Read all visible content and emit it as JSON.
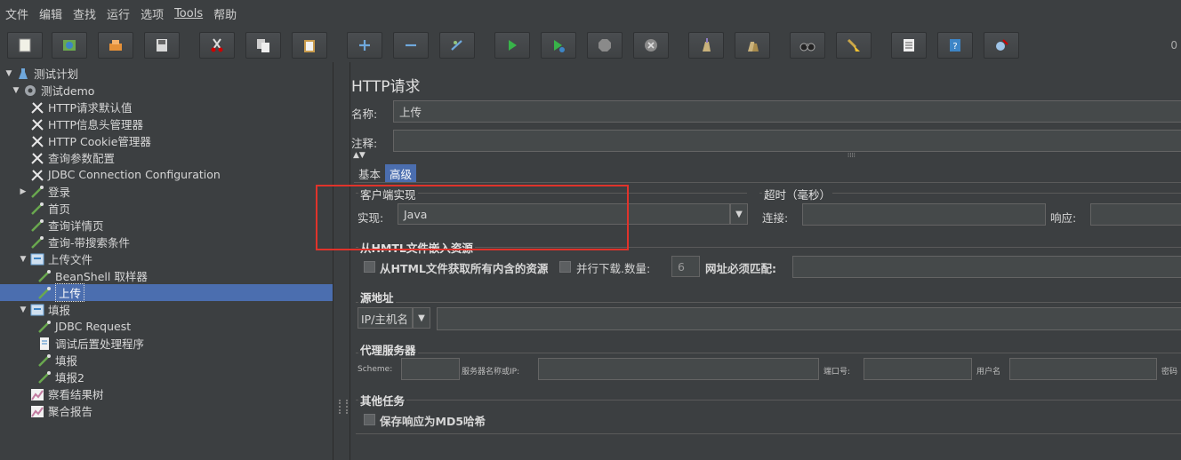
{
  "menubar": {
    "items": [
      "文件",
      "编辑",
      "查找",
      "运行",
      "选项",
      "Tools",
      "帮助"
    ]
  },
  "toolbar": {
    "buttons": [
      {
        "icon": "new-file-icon"
      },
      {
        "icon": "templates-icon"
      },
      {
        "icon": "open-icon"
      },
      {
        "icon": "save-icon"
      },
      {
        "icon": "cut-icon"
      },
      {
        "icon": "copy-icon"
      },
      {
        "icon": "paste-icon"
      },
      {
        "icon": "expand-icon"
      },
      {
        "icon": "collapse-icon"
      },
      {
        "icon": "toggle-icon"
      },
      {
        "icon": "start-icon"
      },
      {
        "icon": "start-no-pause-icon"
      },
      {
        "icon": "stop-icon"
      },
      {
        "icon": "shutdown-icon"
      },
      {
        "icon": "clear-icon"
      },
      {
        "icon": "clear-all-icon"
      },
      {
        "icon": "search-icon"
      },
      {
        "icon": "reset-search-icon"
      },
      {
        "icon": "function-helper-icon"
      },
      {
        "icon": "help-icon"
      },
      {
        "icon": "remote-icon"
      }
    ],
    "counter": "0"
  },
  "tree": {
    "items": [
      {
        "label": "测试计划",
        "icon": "flask-icon"
      },
      {
        "label": "测试demo",
        "icon": "gear-icon"
      },
      {
        "label": "HTTP请求默认值",
        "icon": "wrench-icon"
      },
      {
        "label": "HTTP信息头管理器",
        "icon": "wrench-icon"
      },
      {
        "label": "HTTP Cookie管理器",
        "icon": "wrench-icon"
      },
      {
        "label": "查询参数配置",
        "icon": "wrench-icon"
      },
      {
        "label": "JDBC Connection Configuration",
        "icon": "wrench-icon"
      },
      {
        "label": "登录",
        "icon": "pipette-icon"
      },
      {
        "label": "首页",
        "icon": "pipette-icon"
      },
      {
        "label": "查询详情页",
        "icon": "pipette-icon"
      },
      {
        "label": "查询-带搜索条件",
        "icon": "pipette-icon"
      },
      {
        "label": "上传文件",
        "icon": "controller-icon"
      },
      {
        "label": "BeanShell 取样器",
        "icon": "pipette-icon"
      },
      {
        "label": "上传",
        "icon": "pipette-icon"
      },
      {
        "label": "填报",
        "icon": "controller-icon"
      },
      {
        "label": "JDBC Request",
        "icon": "pipette-icon"
      },
      {
        "label": "调试后置处理程序",
        "icon": "document-icon"
      },
      {
        "label": "填报",
        "icon": "pipette-icon"
      },
      {
        "label": "填报2",
        "icon": "pipette-icon"
      },
      {
        "label": "察看结果树",
        "icon": "chart-icon"
      },
      {
        "label": "聚合报告",
        "icon": "chart-icon"
      }
    ]
  },
  "panel": {
    "title": "HTTP请求",
    "name_label": "名称:",
    "name_value": "上传",
    "comment_label": "注释:",
    "tabs": [
      "基本",
      "高级"
    ],
    "client": {
      "title": "客户端实现",
      "impl_label": "实现:",
      "impl_value": "Java"
    },
    "timeout": {
      "title": "超时（毫秒）",
      "connect_label": "连接:",
      "response_label": "响应:"
    },
    "embedded": {
      "title": "从HMTL文件嵌入资源",
      "retrieve_label": "从HTML文件获取所有内含的资源",
      "parallel_label": "并行下载.数量:",
      "parallel_value": "6",
      "url_match_label": "网址必须匹配:"
    },
    "source": {
      "title": "源地址",
      "type_value": "IP/主机名"
    },
    "proxy": {
      "title": "代理服务器",
      "scheme_label": "Scheme:",
      "server_label": "服务器名称或IP:",
      "port_label": "端口号:",
      "user_label": "用户名",
      "password_label": "密码"
    },
    "other": {
      "title": "其他任务",
      "md5_label": "保存响应为MD5哈希"
    }
  }
}
